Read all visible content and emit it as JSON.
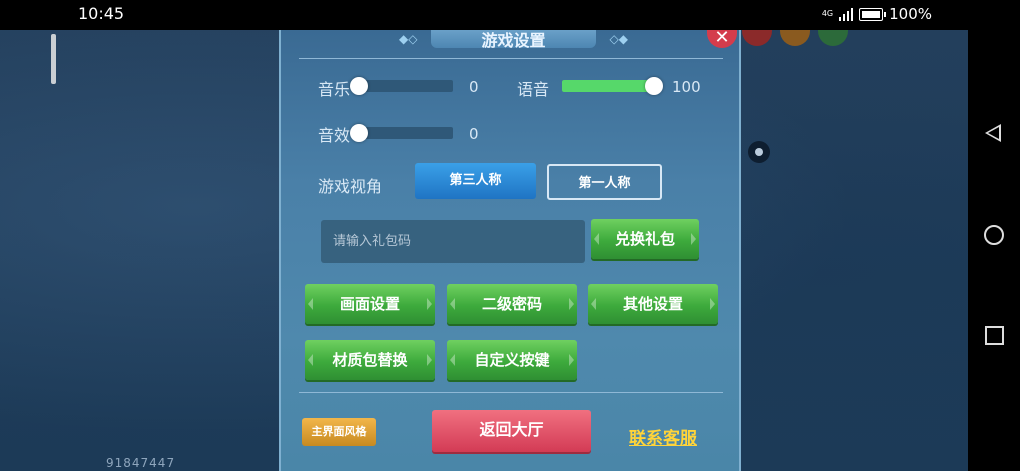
{
  "status_bar": {
    "time": "10:45",
    "network": "4G",
    "battery": "100%"
  },
  "game": {
    "uid": "91847447"
  },
  "panel": {
    "title": "游戏设置",
    "music": {
      "label": "音乐",
      "value": "0",
      "level": 0
    },
    "voice": {
      "label": "语音",
      "value": "100",
      "level": 100
    },
    "sfx": {
      "label": "音效",
      "value": "0",
      "level": 0
    },
    "view": {
      "label": "游戏视角",
      "third_person": "第三人称",
      "first_person": "第一人称",
      "selected": "第三人称"
    },
    "gift": {
      "placeholder": "请输入礼包码",
      "redeem": "兑换礼包"
    },
    "buttons": {
      "graphics": "画面设置",
      "second_password": "二级密码",
      "other": "其他设置",
      "texture": "材质包替换",
      "custom_keys": "自定义按键"
    },
    "footer": {
      "ui_style": "主界面风格",
      "back_lobby": "返回大厅",
      "customer_service": "联系客服"
    }
  },
  "colors": {
    "accent_green": "#56d86a",
    "panel_blue": "#4a80a8",
    "close_red": "#d43c4c",
    "link_yellow": "#ffd43a"
  }
}
